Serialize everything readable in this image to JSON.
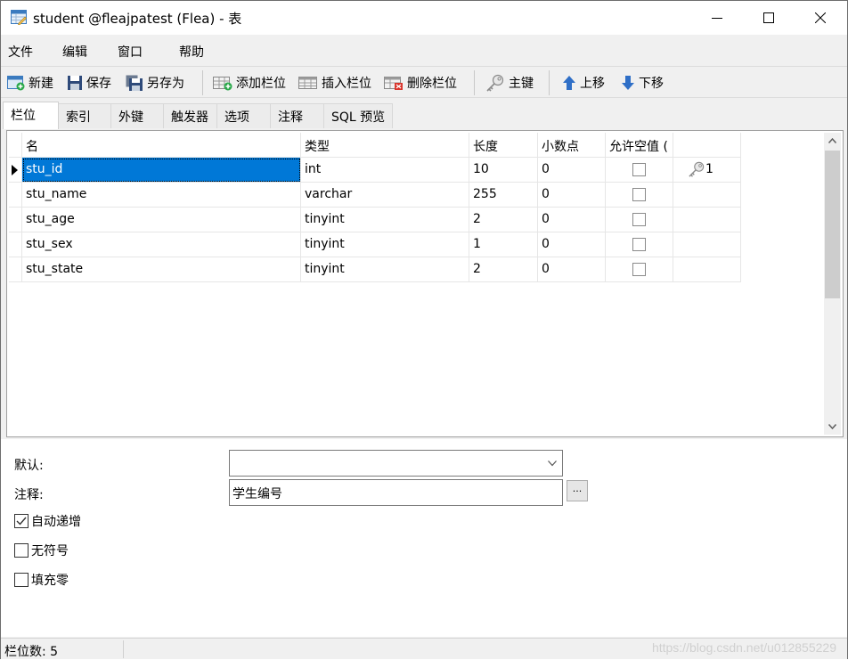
{
  "window": {
    "title": "student @fleajpatest (Flea) - 表",
    "controls": {
      "minimize": "minimize-icon",
      "maximize": "maximize-icon",
      "close": "close-icon"
    }
  },
  "menubar": {
    "items": [
      "文件",
      "编辑",
      "窗口",
      "帮助"
    ]
  },
  "toolbar": {
    "new_label": "新建",
    "save_label": "保存",
    "save_as_label": "另存为",
    "add_column_label": "添加栏位",
    "insert_column_label": "插入栏位",
    "delete_column_label": "删除栏位",
    "primary_key_label": "主键",
    "move_up_label": "上移",
    "move_down_label": "下移"
  },
  "tabs": [
    "栏位",
    "索引",
    "外键",
    "触发器",
    "选项",
    "注释",
    "SQL 预览"
  ],
  "active_tab": "栏位",
  "grid": {
    "columns": [
      "名",
      "类型",
      "长度",
      "小数点",
      "允许空值 (",
      ""
    ],
    "rows": [
      {
        "name": "stu_id",
        "type": "int",
        "length": "10",
        "decimals": "0",
        "nullable": false,
        "key": "1",
        "selected": true
      },
      {
        "name": "stu_name",
        "type": "varchar",
        "length": "255",
        "decimals": "0",
        "nullable": false,
        "key": ""
      },
      {
        "name": "stu_age",
        "type": "tinyint",
        "length": "2",
        "decimals": "0",
        "nullable": false,
        "key": ""
      },
      {
        "name": "stu_sex",
        "type": "tinyint",
        "length": "1",
        "decimals": "0",
        "nullable": false,
        "key": ""
      },
      {
        "name": "stu_state",
        "type": "tinyint",
        "length": "2",
        "decimals": "0",
        "nullable": false,
        "key": ""
      }
    ]
  },
  "properties": {
    "default_label": "默认:",
    "default_value": "",
    "comment_label": "注释:",
    "comment_value": "学生编号",
    "ellipsis_label": "...",
    "auto_increment_label": "自动递增",
    "auto_increment": true,
    "unsigned_label": "无符号",
    "unsigned": false,
    "zerofill_label": "填充零",
    "zerofill": false
  },
  "statusbar": {
    "field_count": "栏位数: 5",
    "watermark": "https://blog.csdn.net/u012855229"
  }
}
